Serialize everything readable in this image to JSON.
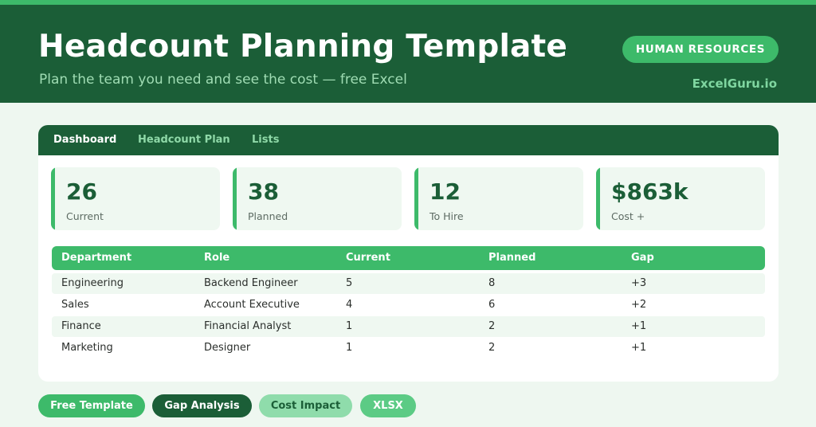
{
  "header": {
    "title": "Headcount Planning Template",
    "subtitle": "Plan the team you need and see the cost — free Excel",
    "category_badge": "HUMAN RESOURCES",
    "brand": "ExcelGuru.io"
  },
  "tabs": [
    {
      "label": "Dashboard",
      "active": true
    },
    {
      "label": "Headcount Plan",
      "active": false
    },
    {
      "label": "Lists",
      "active": false
    }
  ],
  "stats": [
    {
      "value": "26",
      "label": "Current"
    },
    {
      "value": "38",
      "label": "Planned"
    },
    {
      "value": "12",
      "label": "To Hire"
    },
    {
      "value": "$863k",
      "label": "Cost +"
    }
  ],
  "table": {
    "headers": [
      "Department",
      "Role",
      "Current",
      "Planned",
      "Gap"
    ],
    "rows": [
      [
        "Engineering",
        "Backend Engineer",
        "5",
        "8",
        "+3"
      ],
      [
        "Sales",
        "Account Executive",
        "4",
        "6",
        "+2"
      ],
      [
        "Finance",
        "Financial Analyst",
        "1",
        "2",
        "+1"
      ],
      [
        "Marketing",
        "Designer",
        "1",
        "2",
        "+1"
      ]
    ]
  },
  "tags": [
    "Free Template",
    "Gap Analysis",
    "Cost Impact",
    "XLSX"
  ],
  "colors": {
    "dark_green": "#1b5e37",
    "accent_green": "#3dba6a",
    "light_bg": "#eef7f0"
  }
}
